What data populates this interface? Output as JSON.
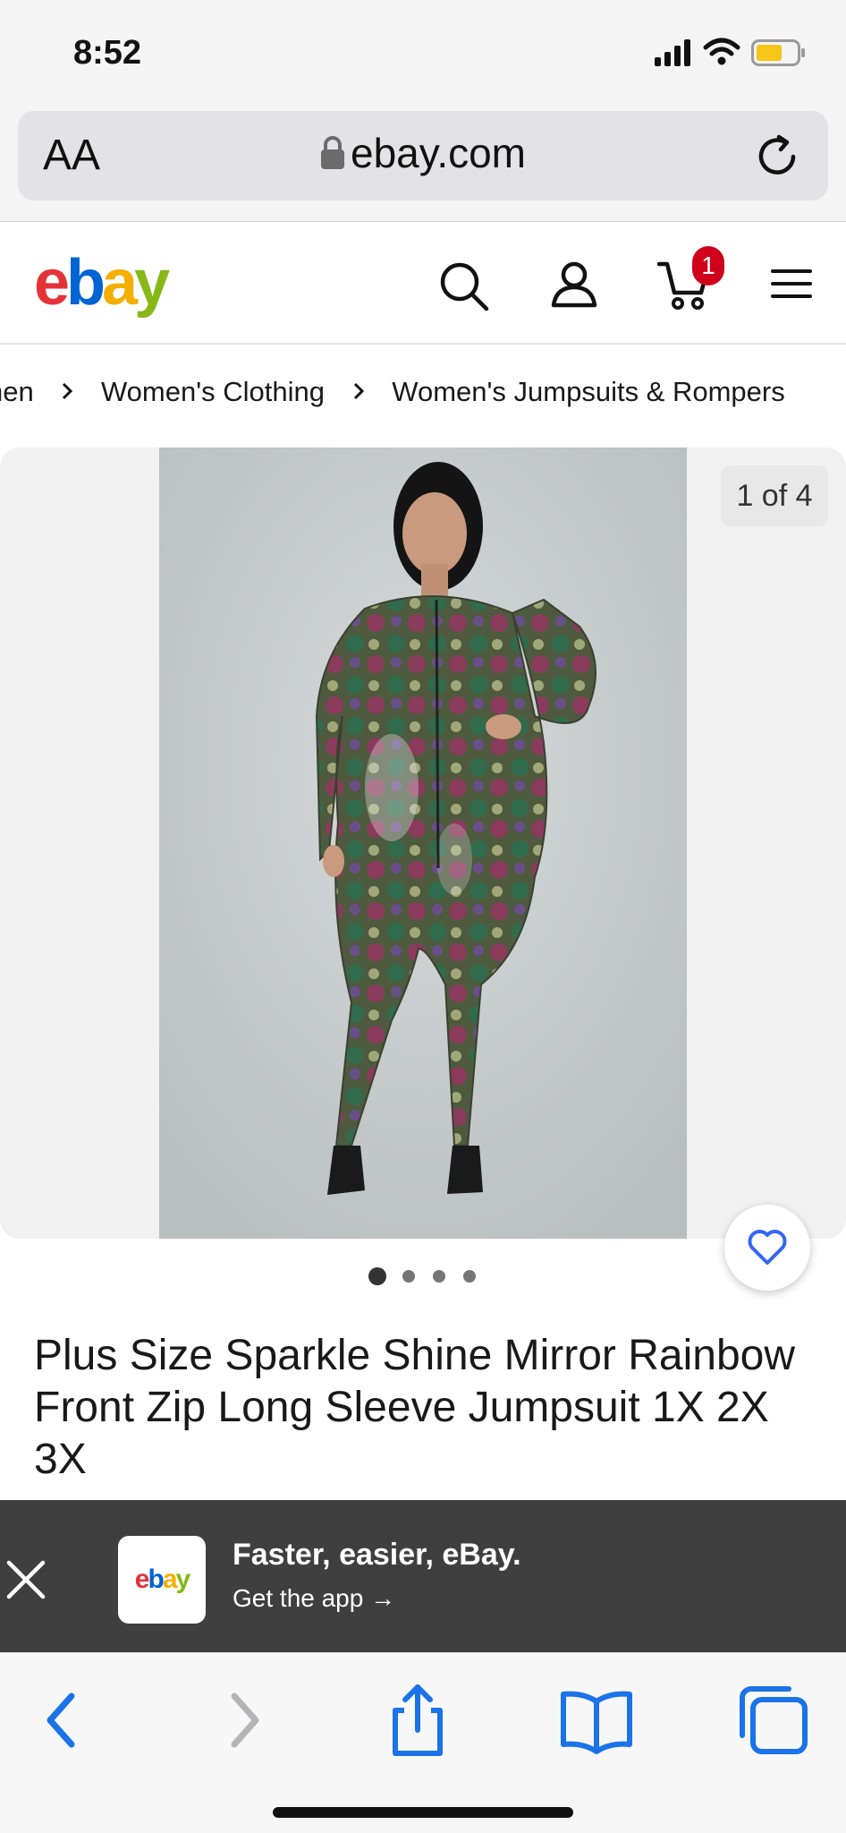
{
  "status": {
    "time": "8:52"
  },
  "browser": {
    "text_size_label": "AA",
    "host": "ebay.com"
  },
  "header": {
    "logo_letters": [
      "e",
      "b",
      "a",
      "y"
    ],
    "cart_count": "1"
  },
  "breadcrumbs": [
    "nen",
    "Women's Clothing",
    "Women's Jumpsuits & Rompers"
  ],
  "gallery": {
    "counter": "1 of 4",
    "total_images": 4,
    "active_index": 0
  },
  "product": {
    "title": "Plus Size Sparkle Shine Mirror Rainbow Front Zip Long Sleeve Jumpsuit 1X 2X 3X"
  },
  "app_banner": {
    "logo_text": "ebay",
    "title": "Faster, easier, eBay.",
    "subtitle": "Get the app →"
  },
  "colors": {
    "ebay_red": "#e53238",
    "ebay_blue": "#0064d2",
    "ebay_yellow": "#f5af02",
    "ebay_green": "#86b817",
    "safari_blue": "#1a73e8",
    "badge_red": "#d0021b",
    "heart_blue": "#3665f3"
  }
}
